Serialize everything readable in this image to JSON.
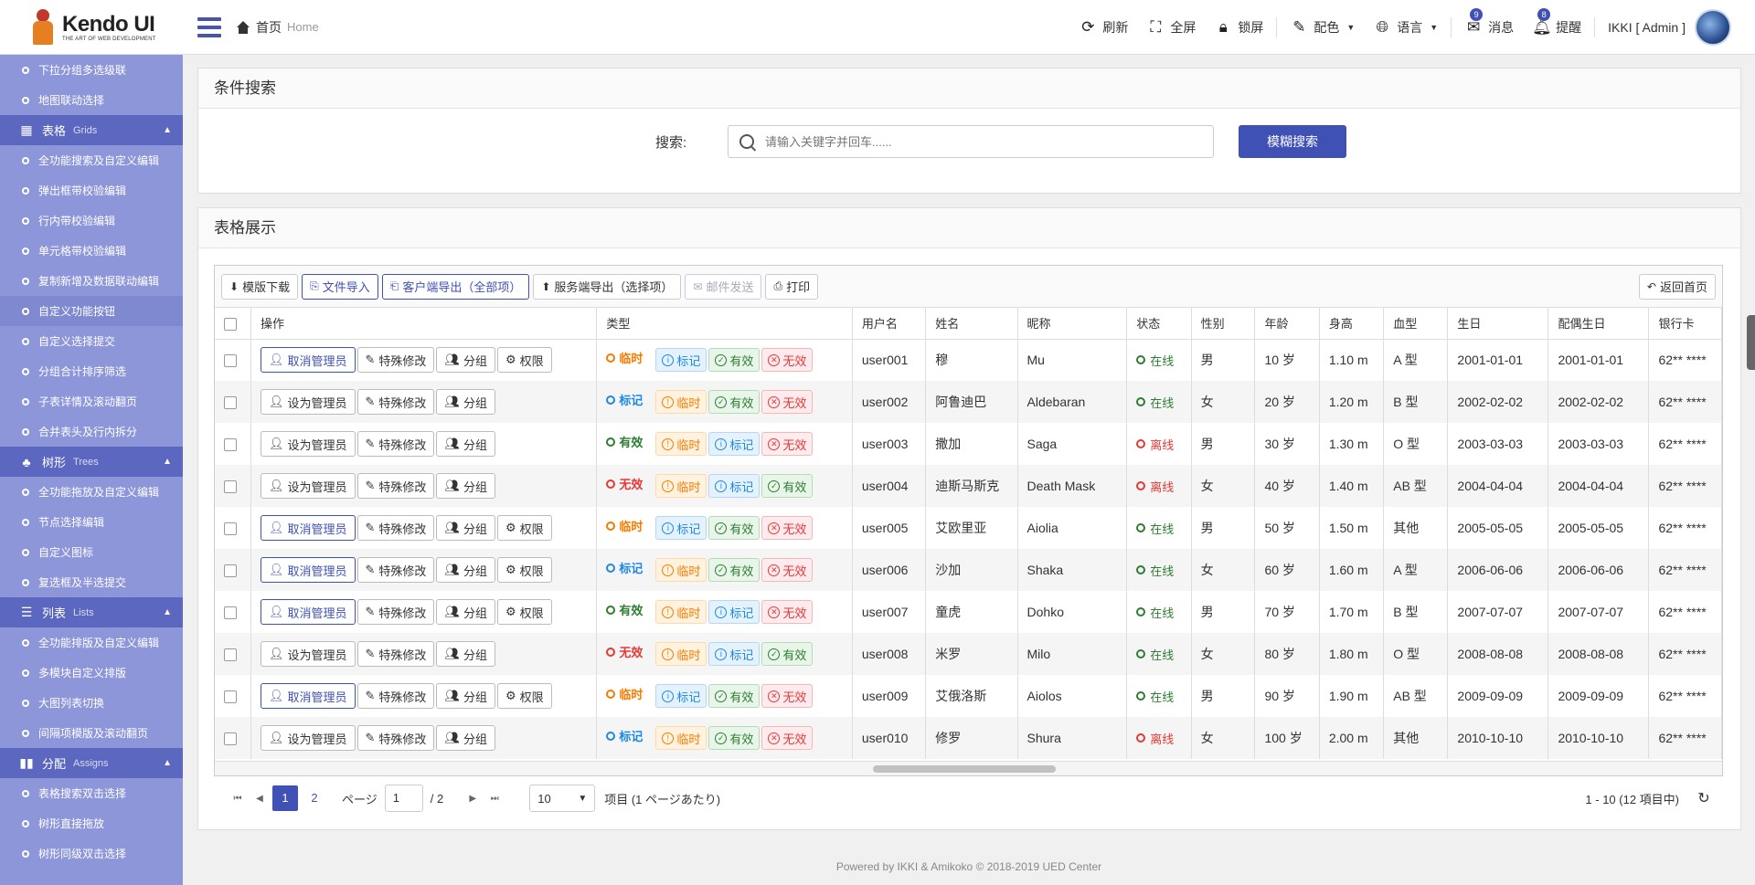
{
  "header": {
    "logo_title": "Kendo UI",
    "logo_sub": "THE ART OF WEB DEVELOPMENT",
    "crumb_home": "首页",
    "crumb_en": "Home",
    "tools": {
      "refresh": "刷新",
      "fullscreen": "全屏",
      "lock": "锁屏",
      "color": "配色",
      "language": "语言",
      "messages": "消息",
      "messages_count": "9",
      "reminders": "提醒",
      "reminders_count": "8"
    },
    "user": "IKKI [ Admin ]"
  },
  "sidebar": {
    "top_items": [
      "下拉分组多选级联",
      "地图联动选择"
    ],
    "group_grids": {
      "label": "表格",
      "en": "Grids"
    },
    "grid_items": [
      "全功能搜索及自定义编辑",
      "弹出框带校验编辑",
      "行内带校验编辑",
      "单元格带校验编辑",
      "复制新增及数据联动编辑",
      "自定义功能按钮",
      "自定义选择提交",
      "分组合计排序筛选",
      "子表详情及滚动翻页",
      "合并表头及行内拆分"
    ],
    "group_trees": {
      "label": "树形",
      "en": "Trees"
    },
    "tree_items": [
      "全功能拖放及自定义编辑",
      "节点选择编辑",
      "自定义图标",
      "复选框及半选提交"
    ],
    "group_lists": {
      "label": "列表",
      "en": "Lists"
    },
    "list_items": [
      "全功能排版及自定义编辑",
      "多模块自定义排版",
      "大图列表切换",
      "间隔项模版及滚动翻页"
    ],
    "group_assigns": {
      "label": "分配",
      "en": "Assigns"
    },
    "assign_items": [
      "表格搜索双击选择",
      "树形直接拖放",
      "树形同级双击选择"
    ]
  },
  "search": {
    "title": "条件搜索",
    "label": "搜索:",
    "placeholder": "请输入关键字并回车......",
    "button": "模糊搜索"
  },
  "grid": {
    "title": "表格展示",
    "toolbar": {
      "template_download": "模版下载",
      "file_import": "文件导入",
      "client_export": "客户端导出（全部项）",
      "server_export": "服务端导出（选择项）",
      "mail_send": "邮件发送",
      "print": "打印",
      "back_home": "返回首页"
    },
    "columns": [
      "操作",
      "类型",
      "用户名",
      "姓名",
      "昵称",
      "状态",
      "性别",
      "年龄",
      "身高",
      "血型",
      "生日",
      "配偶生日",
      "银行卡"
    ],
    "labels": {
      "cancel_admin": "取消管理员",
      "set_admin": "设为管理员",
      "special_edit": "特殊修改",
      "group": "分组",
      "permission": "权限",
      "temp": "临时",
      "mark": "标记",
      "valid": "有效",
      "invalid": "无效",
      "online": "在线",
      "offline": "离线"
    },
    "rows": [
      {
        "admin": true,
        "type": "temp",
        "tags": [
          "mark",
          "valid",
          "invalid"
        ],
        "username": "user001",
        "name": "穆",
        "nick": "Mu",
        "online": true,
        "gender": "男",
        "age": "10 岁",
        "height": "1.10 m",
        "blood": "A 型",
        "birthday": "2001-01-01",
        "spouse": "2001-01-01",
        "card": "62** ****"
      },
      {
        "admin": false,
        "type": "mark",
        "tags": [
          "temp",
          "valid",
          "invalid"
        ],
        "username": "user002",
        "name": "阿鲁迪巴",
        "nick": "Aldebaran",
        "online": true,
        "gender": "女",
        "age": "20 岁",
        "height": "1.20 m",
        "blood": "B 型",
        "birthday": "2002-02-02",
        "spouse": "2002-02-02",
        "card": "62** ****"
      },
      {
        "admin": false,
        "type": "valid",
        "tags": [
          "temp",
          "mark",
          "invalid"
        ],
        "username": "user003",
        "name": "撒加",
        "nick": "Saga",
        "online": false,
        "gender": "男",
        "age": "30 岁",
        "height": "1.30 m",
        "blood": "O 型",
        "birthday": "2003-03-03",
        "spouse": "2003-03-03",
        "card": "62** ****"
      },
      {
        "admin": false,
        "type": "invalid",
        "tags": [
          "temp",
          "mark",
          "valid"
        ],
        "username": "user004",
        "name": "迪斯马斯克",
        "nick": "Death Mask",
        "online": false,
        "gender": "女",
        "age": "40 岁",
        "height": "1.40 m",
        "blood": "AB 型",
        "birthday": "2004-04-04",
        "spouse": "2004-04-04",
        "card": "62** ****"
      },
      {
        "admin": true,
        "type": "temp",
        "tags": [
          "mark",
          "valid",
          "invalid"
        ],
        "username": "user005",
        "name": "艾欧里亚",
        "nick": "Aiolia",
        "online": true,
        "gender": "男",
        "age": "50 岁",
        "height": "1.50 m",
        "blood": "其他",
        "birthday": "2005-05-05",
        "spouse": "2005-05-05",
        "card": "62** ****"
      },
      {
        "admin": true,
        "type": "mark",
        "tags": [
          "temp",
          "valid",
          "invalid"
        ],
        "username": "user006",
        "name": "沙加",
        "nick": "Shaka",
        "online": true,
        "gender": "女",
        "age": "60 岁",
        "height": "1.60 m",
        "blood": "A 型",
        "birthday": "2006-06-06",
        "spouse": "2006-06-06",
        "card": "62** ****"
      },
      {
        "admin": true,
        "type": "valid",
        "tags": [
          "temp",
          "mark",
          "invalid"
        ],
        "username": "user007",
        "name": "童虎",
        "nick": "Dohko",
        "online": true,
        "gender": "男",
        "age": "70 岁",
        "height": "1.70 m",
        "blood": "B 型",
        "birthday": "2007-07-07",
        "spouse": "2007-07-07",
        "card": "62** ****"
      },
      {
        "admin": false,
        "type": "invalid",
        "tags": [
          "temp",
          "mark",
          "valid"
        ],
        "username": "user008",
        "name": "米罗",
        "nick": "Milo",
        "online": true,
        "gender": "女",
        "age": "80 岁",
        "height": "1.80 m",
        "blood": "O 型",
        "birthday": "2008-08-08",
        "spouse": "2008-08-08",
        "card": "62** ****"
      },
      {
        "admin": true,
        "type": "temp",
        "tags": [
          "mark",
          "valid",
          "invalid"
        ],
        "username": "user009",
        "name": "艾俄洛斯",
        "nick": "Aiolos",
        "online": true,
        "gender": "男",
        "age": "90 岁",
        "height": "1.90 m",
        "blood": "AB 型",
        "birthday": "2009-09-09",
        "spouse": "2009-09-09",
        "card": "62** ****"
      },
      {
        "admin": false,
        "type": "mark",
        "tags": [
          "temp",
          "valid",
          "invalid"
        ],
        "username": "user010",
        "name": "修罗",
        "nick": "Shura",
        "online": false,
        "gender": "女",
        "age": "100 岁",
        "height": "2.00 m",
        "blood": "其他",
        "birthday": "2010-10-10",
        "spouse": "2010-10-10",
        "card": "62** ****"
      }
    ]
  },
  "pager": {
    "pages": [
      "1",
      "2"
    ],
    "current": "1",
    "page_label": "ページ",
    "page_input": "1",
    "page_total": "/ 2",
    "page_size": "10",
    "items_per_page": "项目 (1 ページあたり)",
    "info": "1 - 10 (12 項目中)"
  },
  "footer": "Powered by IKKI & Amikoko © 2018-2019 UED Center",
  "colors": {
    "accent": "#3f51b5",
    "sidebar": "#8d96d8",
    "sidebar_group": "#5c67bf",
    "online": "#2e7d32",
    "offline": "#e53935"
  }
}
